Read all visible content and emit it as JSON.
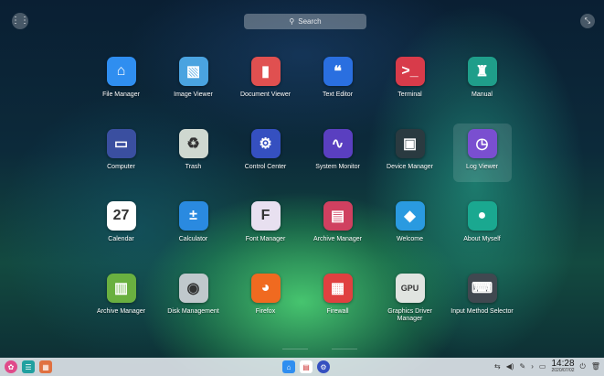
{
  "search": {
    "placeholder": "Search",
    "icon": "search-icon"
  },
  "launcher": {
    "apps": [
      {
        "label": "File Manager",
        "icon": "folder-icon",
        "glyph": "⌂",
        "bg": "#2f8ef0"
      },
      {
        "label": "Image Viewer",
        "icon": "image-icon",
        "glyph": "▧",
        "bg": "#4aa3e0"
      },
      {
        "label": "Document Viewer",
        "icon": "document-icon",
        "glyph": "▮",
        "bg": "#e05050"
      },
      {
        "label": "Text Editor",
        "icon": "text-editor-icon",
        "glyph": "❝",
        "bg": "#2a6fe0"
      },
      {
        "label": "Terminal",
        "icon": "terminal-icon",
        "glyph": ">_",
        "bg": "#d83b4a"
      },
      {
        "label": "Manual",
        "icon": "manual-icon",
        "glyph": "♜",
        "bg": "#1f9e8a"
      },
      {
        "label": "Computer",
        "icon": "computer-icon",
        "glyph": "▭",
        "bg": "#3a4fa0"
      },
      {
        "label": "Trash",
        "icon": "trash-icon",
        "glyph": "♻",
        "bg": "#cfd8d0"
      },
      {
        "label": "Control Center",
        "icon": "control-center-icon",
        "glyph": "⚙",
        "bg": "#3550c0"
      },
      {
        "label": "System Monitor",
        "icon": "system-monitor-icon",
        "glyph": "∿",
        "bg": "#5a3fc0"
      },
      {
        "label": "Device Manager",
        "icon": "device-manager-icon",
        "glyph": "▣",
        "bg": "#2a3a40"
      },
      {
        "label": "Log Viewer",
        "icon": "log-viewer-icon",
        "glyph": "◷",
        "bg": "#7a4fd0"
      },
      {
        "label": "Calendar",
        "icon": "calendar-icon",
        "glyph": "27",
        "bg": "#ffffff"
      },
      {
        "label": "Calculator",
        "icon": "calculator-icon",
        "glyph": "±",
        "bg": "#2a8ae0"
      },
      {
        "label": "Font Manager",
        "icon": "font-manager-icon",
        "glyph": "F",
        "bg": "#e8e0f0"
      },
      {
        "label": "Archive Manager",
        "icon": "archive-manager-icon",
        "glyph": "▤",
        "bg": "#d04060"
      },
      {
        "label": "Welcome",
        "icon": "welcome-icon",
        "glyph": "◆",
        "bg": "#2a9ae0"
      },
      {
        "label": "About Myself",
        "icon": "about-myself-icon",
        "glyph": "●",
        "bg": "#1aa890"
      },
      {
        "label": "Archive Manager",
        "icon": "archive-manager-green-icon",
        "glyph": "▥",
        "bg": "#6ab040"
      },
      {
        "label": "Disk Management",
        "icon": "disk-management-icon",
        "glyph": "◉",
        "bg": "#c0c8cc"
      },
      {
        "label": "Firefox",
        "icon": "firefox-icon",
        "glyph": "◕",
        "bg": "#f06a20"
      },
      {
        "label": "Firewall",
        "icon": "firewall-icon",
        "glyph": "▦",
        "bg": "#e04040"
      },
      {
        "label": "Graphics Driver Manager",
        "icon": "gpu-icon",
        "glyph": "GPU",
        "bg": "#e0e4e0"
      },
      {
        "label": "Input Method Selector",
        "icon": "keyboard-icon",
        "glyph": "⌨",
        "bg": "#404850"
      }
    ]
  },
  "dock": {
    "clock_time": "14:28",
    "clock_date": "2020/07/02"
  }
}
